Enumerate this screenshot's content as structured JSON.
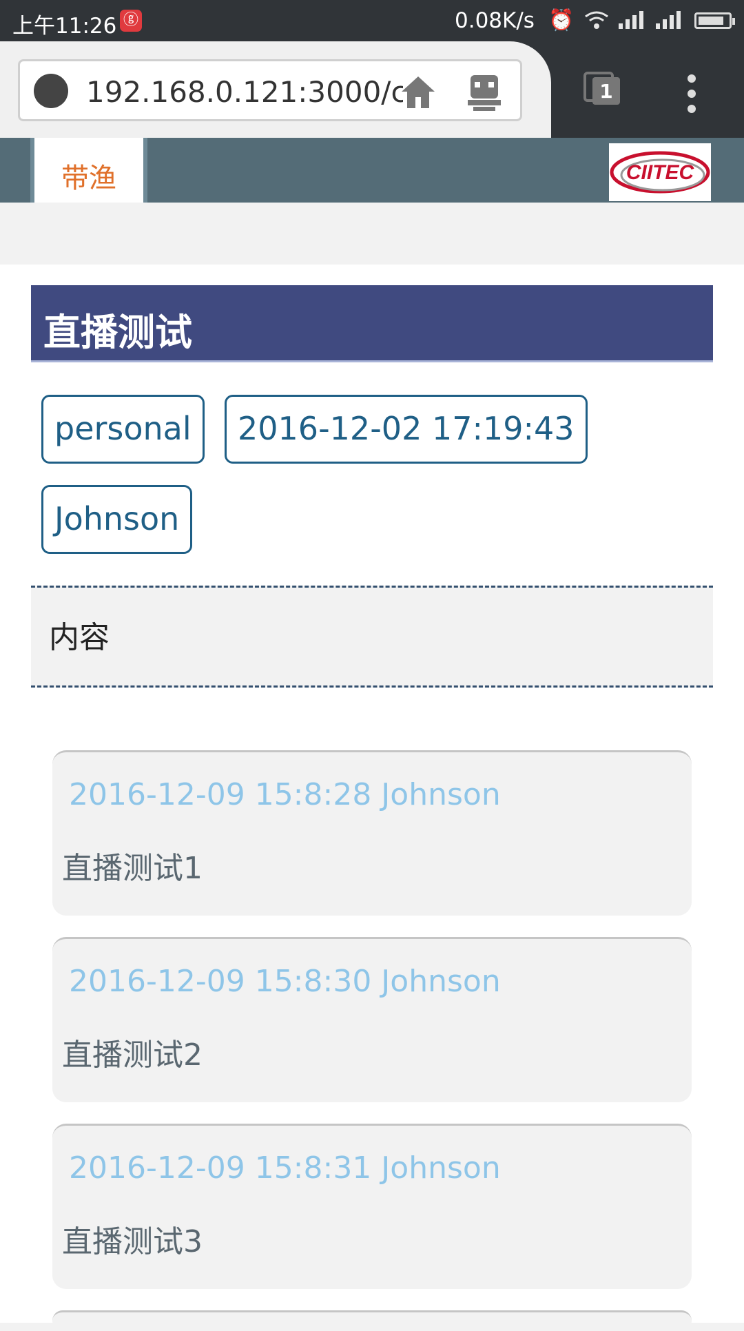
{
  "status_bar": {
    "time": "上午11:26",
    "app_badge": "ⓖ",
    "net_speed": "0.08K/s",
    "icons": [
      "alarm-icon",
      "wifi-icon",
      "signal-icon",
      "signal-icon",
      "battery-icon"
    ],
    "battery_level": 0.85
  },
  "browser": {
    "url": "192.168.0.121:3000/c",
    "tab_count": "1",
    "icons": [
      "globe-icon",
      "home-icon",
      "robot-icon",
      "tabs-icon",
      "overflow-menu-icon"
    ]
  },
  "header": {
    "brand": "带渔",
    "logo_text": "CIITEC",
    "accent": "#546c77",
    "brand_color": "#e0702a"
  },
  "post": {
    "title": "直播测试",
    "tags": [
      "personal",
      "2016-12-02 17:19:43",
      "Johnson"
    ],
    "description": "内容",
    "title_bg": "#404a80",
    "tag_color": "#1f5f86"
  },
  "comments": [
    {
      "meta": "2016-12-09 15:8:28 Johnson",
      "body": "直播测试1"
    },
    {
      "meta": "2016-12-09 15:8:30 Johnson",
      "body": "直播测试2"
    },
    {
      "meta": "2016-12-09 15:8:31 Johnson",
      "body": "直播测试3"
    }
  ]
}
